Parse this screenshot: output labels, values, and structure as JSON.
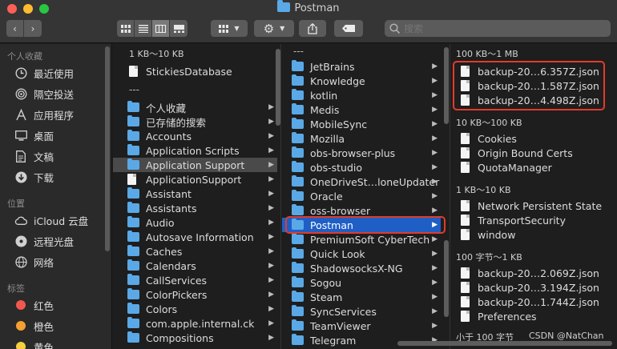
{
  "window": {
    "title": "Postman"
  },
  "toolbar": {
    "back_icon": "chevron-left-icon",
    "forward_icon": "chevron-right-icon",
    "view_modes": [
      "icon-view",
      "list-view",
      "column-view",
      "gallery-view"
    ],
    "search_placeholder": "搜索"
  },
  "sidebar": {
    "favorites_header": "个人收藏",
    "favorites": [
      {
        "label": "最近使用",
        "icon": "clock-icon"
      },
      {
        "label": "隔空投送",
        "icon": "airdrop-icon"
      },
      {
        "label": "应用程序",
        "icon": "applications-icon"
      },
      {
        "label": "桌面",
        "icon": "desktop-icon"
      },
      {
        "label": "文稿",
        "icon": "documents-icon"
      },
      {
        "label": "下载",
        "icon": "download-icon"
      }
    ],
    "locations_header": "位置",
    "locations": [
      {
        "label": "iCloud 云盘",
        "icon": "cloud-icon"
      },
      {
        "label": "远程光盘",
        "icon": "disc-icon"
      },
      {
        "label": "网络",
        "icon": "network-icon"
      }
    ],
    "tags_header": "标签",
    "tags": [
      {
        "label": "红色",
        "color": "#f0584f"
      },
      {
        "label": "橙色",
        "color": "#f6a032"
      },
      {
        "label": "黄色",
        "color": "#f6cf3f"
      }
    ]
  },
  "column1": {
    "group1": "1 KB～10 KB",
    "group1_items": [
      {
        "label": "StickiesDatabase",
        "type": "doc"
      }
    ],
    "separator": "---",
    "items": [
      {
        "label": "个人收藏",
        "type": "folder"
      },
      {
        "label": "已存储的搜索",
        "type": "folder"
      },
      {
        "label": "Accounts",
        "type": "folder"
      },
      {
        "label": "Application Scripts",
        "type": "folder"
      },
      {
        "label": "Application Support",
        "type": "folder",
        "selected": true
      },
      {
        "label": "ApplicationSupport",
        "type": "alias"
      },
      {
        "label": "Assistant",
        "type": "folder"
      },
      {
        "label": "Assistants",
        "type": "folder"
      },
      {
        "label": "Audio",
        "type": "folder"
      },
      {
        "label": "Autosave Information",
        "type": "folder"
      },
      {
        "label": "Caches",
        "type": "folder"
      },
      {
        "label": "Calendars",
        "type": "folder"
      },
      {
        "label": "CallServices",
        "type": "folder"
      },
      {
        "label": "ColorPickers",
        "type": "folder"
      },
      {
        "label": "Colors",
        "type": "folder"
      },
      {
        "label": "com.apple.internal.ck",
        "type": "folder"
      },
      {
        "label": "Compositions",
        "type": "folder"
      }
    ]
  },
  "column2": {
    "separator": "---",
    "items": [
      {
        "label": "JetBrains"
      },
      {
        "label": "Knowledge"
      },
      {
        "label": "kotlin"
      },
      {
        "label": "Medis"
      },
      {
        "label": "MobileSync"
      },
      {
        "label": "Mozilla"
      },
      {
        "label": "obs-browser-plus"
      },
      {
        "label": "obs-studio"
      },
      {
        "label": "OneDriveSt…loneUpdater"
      },
      {
        "label": "Oracle"
      },
      {
        "label": "oss-browser"
      },
      {
        "label": "Postman",
        "selected": true
      },
      {
        "label": "PremiumSoft CyberTech"
      },
      {
        "label": "Quick Look"
      },
      {
        "label": "ShadowsocksX-NG"
      },
      {
        "label": "Sogou"
      },
      {
        "label": "Steam"
      },
      {
        "label": "SyncServices"
      },
      {
        "label": "TeamViewer"
      },
      {
        "label": "Telegram"
      }
    ]
  },
  "column3": {
    "groups": [
      {
        "header": "100 KB～1 MB",
        "items": [
          "backup-20…6.357Z.json",
          "backup-20…1.587Z.json",
          "backup-20…4.498Z.json"
        ]
      },
      {
        "header": "10 KB～100 KB",
        "items": [
          "Cookies",
          "Origin Bound Certs",
          "QuotaManager"
        ]
      },
      {
        "header": "1 KB～10 KB",
        "items": [
          "Network Persistent State",
          "TransportSecurity",
          "window"
        ]
      },
      {
        "header": "100 字节～1 KB",
        "items": [
          "backup-20…2.069Z.json",
          "backup-20…3.194Z.json",
          "backup-20…1.744Z.json",
          "Preferences"
        ]
      },
      {
        "header": "小于 100 字节",
        "items": []
      }
    ]
  },
  "watermark": "CSDN @NatChan"
}
